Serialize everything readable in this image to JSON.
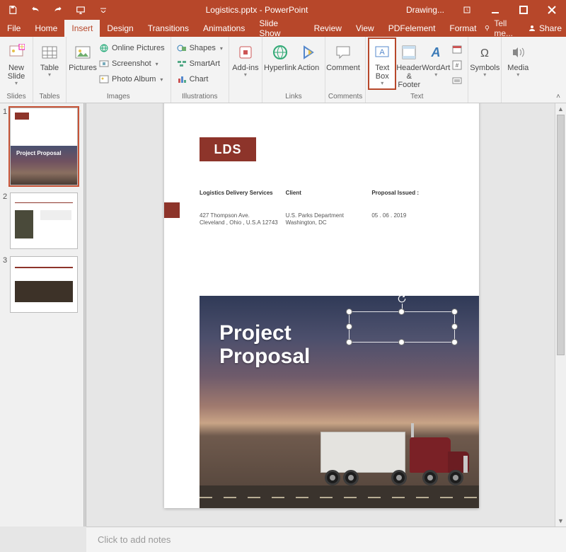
{
  "titlebar": {
    "document": "Logistics.pptx - PowerPoint",
    "context_tab": "Drawing..."
  },
  "menu": {
    "file": "File",
    "home": "Home",
    "insert": "Insert",
    "design": "Design",
    "transitions": "Transitions",
    "animations": "Animations",
    "slideshow": "Slide Show",
    "review": "Review",
    "view": "View",
    "pdfelement": "PDFelement",
    "format": "Format",
    "tell_me": "Tell me...",
    "share": "Share"
  },
  "ribbon": {
    "groups": {
      "slides": "Slides",
      "tables": "Tables",
      "images": "Images",
      "illustrations": "Illustrations",
      "links": "Links",
      "comments": "Comments",
      "text": "Text"
    },
    "new_slide": "New Slide",
    "table": "Table",
    "pictures": "Pictures",
    "online_pictures": "Online Pictures",
    "screenshot": "Screenshot",
    "photo_album": "Photo Album",
    "shapes": "Shapes",
    "smartart": "SmartArt",
    "chart": "Chart",
    "addins": "Add-ins",
    "hyperlink": "Hyperlink",
    "action": "Action",
    "comment": "Comment",
    "text_box": "Text Box",
    "header_footer": "Header & Footer",
    "wordart": "WordArt",
    "symbols": "Symbols",
    "media": "Media"
  },
  "thumbs": {
    "n1": "1",
    "n2": "2",
    "n3": "3",
    "proj": "Project Proposal"
  },
  "slide": {
    "lds": "LDS",
    "company": "Logistics Delivery Services",
    "client_hd": "Client",
    "issued_hd": "Proposal Issued :",
    "addr1": "427 Thompson Ave.",
    "addr2": "Cleveland , Ohio , U.S.A 12743",
    "client1": "U.S. Parks Department",
    "client2": "Washington, DC",
    "issued": "05 . 06 . 2019",
    "title1": "Project",
    "title2": "Proposal"
  },
  "notes": {
    "placeholder": "Click to add notes"
  }
}
